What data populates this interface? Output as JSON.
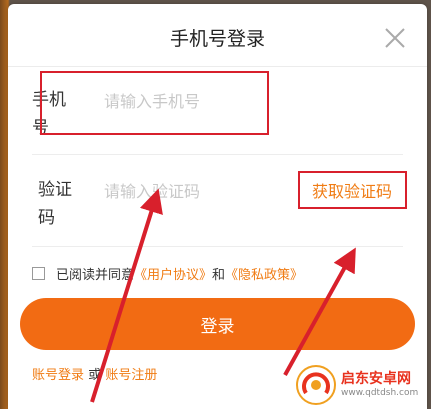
{
  "dialog": {
    "title": "手机号登录",
    "close_icon": "close-icon"
  },
  "phone": {
    "label": "手机号",
    "placeholder": "请输入手机号"
  },
  "code": {
    "label": "验证码",
    "placeholder": "请输入验证码",
    "get_code": "获取验证码"
  },
  "agreement": {
    "prefix": "已阅读并同意",
    "user_agreement": "《用户协议》",
    "and": "和",
    "privacy_policy": "《隐私政策》"
  },
  "login_button": "登录",
  "bottom": {
    "account_login": "账号登录",
    "or": "或",
    "register": "账号注册"
  },
  "watermark": {
    "name": "启东安卓网",
    "url": "www.qdtdsh.com"
  },
  "colors": {
    "accent": "#f26b13",
    "link": "#f07c14",
    "annotation_red": "#d8202c"
  }
}
